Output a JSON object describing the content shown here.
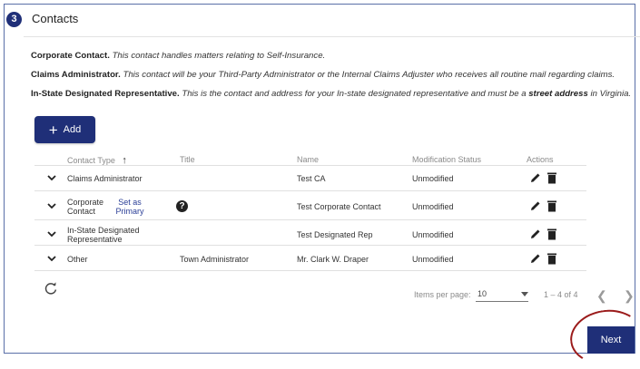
{
  "section": {
    "step_number": "3",
    "title": "Contacts"
  },
  "descriptions": [
    {
      "label": "Corporate Contact.",
      "text": "This contact handles matters relating to Self-Insurance."
    },
    {
      "label": "Claims Administrator.",
      "text": "This contact will be your Third-Party Administrator or the Internal Claims Adjuster who receives all routine mail regarding claims."
    },
    {
      "label": "In-State Designated Representative.",
      "text_before": "This is the contact and address for your In-state designated representative and must be a",
      "emphasis": "street address",
      "text_after": "in Virginia."
    }
  ],
  "add_button": {
    "label": "Add"
  },
  "table": {
    "columns": {
      "contact_type": "Contact Type",
      "title": "Title",
      "name": "Name",
      "modification_status": "Modification Status",
      "actions": "Actions"
    },
    "rows": [
      {
        "contact_type": "Claims Administrator",
        "title": "",
        "name": "Test CA",
        "status": "Unmodified"
      },
      {
        "contact_type_line1": "Corporate",
        "contact_type_line2": "Contact",
        "set_primary_line1": "Set as",
        "set_primary_line2": "Primary",
        "help": "?",
        "title": "",
        "name": "Test Corporate Contact",
        "status": "Unmodified"
      },
      {
        "contact_type_line1": "In-State Designated",
        "contact_type_line2": "Representative",
        "title": "",
        "name": "Test Designated Rep",
        "status": "Unmodified"
      },
      {
        "contact_type": "Other",
        "title": "Town Administrator",
        "name": "Mr. Clark W. Draper",
        "status": "Unmodified"
      }
    ]
  },
  "paginator": {
    "items_per_page_label": "Items per page:",
    "items_per_page_value": "10",
    "range": "1 – 4 of 4"
  },
  "next_button": {
    "label": "Next"
  },
  "colors": {
    "primary": "#1f2f78",
    "link": "#2b3f97",
    "annotation": "#9b1b1b"
  }
}
